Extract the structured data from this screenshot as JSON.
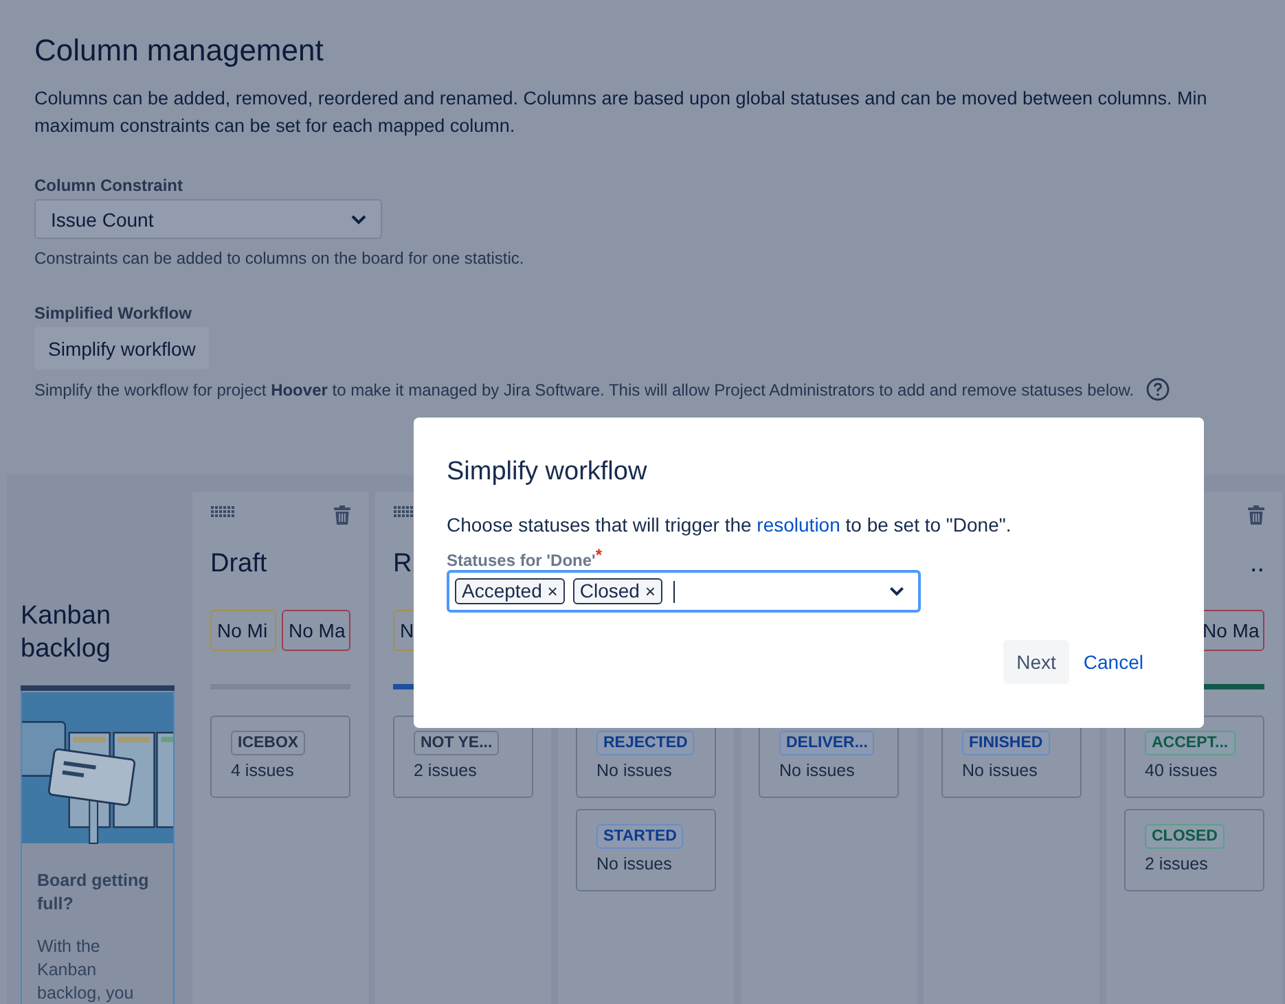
{
  "page": {
    "title": "Column management",
    "description_lines": [
      "Columns can be added, removed, reordered and renamed. Columns are based upon global statuses and can be moved between columns. Min",
      "maximum constraints can be set for each mapped column."
    ]
  },
  "column_constraint": {
    "label": "Column Constraint",
    "value": "Issue Count",
    "help": "Constraints can be added to columns on the board for one statistic."
  },
  "simplified_workflow": {
    "label": "Simplified Workflow",
    "button": "Simplify workflow",
    "note": "Simplify the workflow for project **Hoover** to make it managed by Jira Software. This will allow Project Administrators to add and remove statuses below."
  },
  "backlog": {
    "title": "Kanban backlog",
    "card_title": "Board getting full?",
    "card_text": "With the Kanban backlog, you"
  },
  "columns": [
    {
      "title": "Draft",
      "drag_handle": true,
      "delete": true,
      "constraints": [
        {
          "kind": "min",
          "text": "No Mi"
        },
        {
          "kind": "max",
          "text": "No Ma"
        }
      ],
      "color": "#7d8799",
      "statuses": [
        {
          "name": "ICEBOX",
          "kind": "todo",
          "count": "4 issues"
        }
      ]
    },
    {
      "title": "R",
      "drag_handle": true,
      "delete": false,
      "constraints": [
        {
          "kind": "min",
          "text": "N"
        }
      ],
      "color": "#1f4fa0",
      "statuses": [
        {
          "name": "NOT YE...",
          "kind": "todo",
          "count": "2 issues"
        }
      ]
    },
    {
      "drag_handle": false,
      "delete": false,
      "statuses": [
        {
          "name": "REJECTED",
          "kind": "inprogress",
          "count": "No issues"
        },
        {
          "name": "STARTED",
          "kind": "inprogress",
          "count": "No issues"
        }
      ]
    },
    {
      "drag_handle": false,
      "delete": false,
      "statuses": [
        {
          "name": "DELIVER...",
          "kind": "inprogress",
          "count": "No issues"
        }
      ]
    },
    {
      "drag_handle": false,
      "delete": false,
      "statuses": [
        {
          "name": "FINISHED",
          "kind": "inprogress",
          "count": "No issues"
        }
      ]
    },
    {
      "title_end": "..",
      "drag_handle": false,
      "delete": true,
      "constraints": [
        {
          "kind": "max",
          "text": "No Ma"
        }
      ],
      "color": "#11594a",
      "statuses": [
        {
          "name": "ACCEPT...",
          "kind": "done",
          "count": "40 issues"
        },
        {
          "name": "CLOSED",
          "kind": "done",
          "count": "2 issues"
        }
      ]
    }
  ],
  "dialog": {
    "title": "Simplify workflow",
    "text_before": "Choose statuses that will trigger the",
    "link": "resolution",
    "text_after": "to be set to \"Done\".",
    "field_label": "Statuses for 'Done'",
    "required_mark": "*",
    "chips": [
      {
        "label": "Accepted",
        "remove": "×"
      },
      {
        "label": "Closed",
        "remove": "×"
      }
    ],
    "buttons": [
      {
        "label": "Next",
        "kind": "default"
      },
      {
        "label": "Cancel",
        "kind": "link"
      }
    ]
  }
}
